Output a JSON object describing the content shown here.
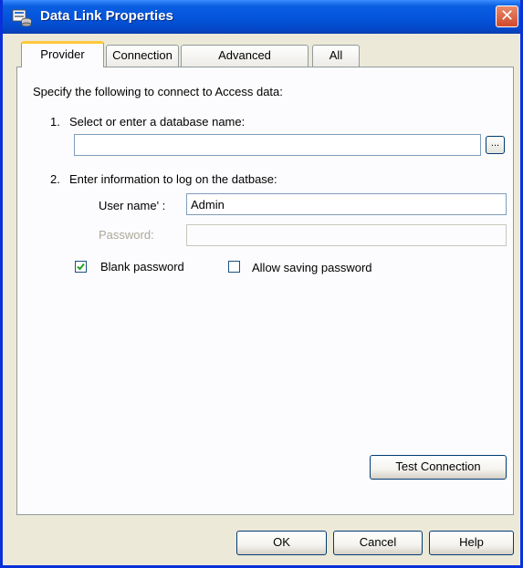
{
  "window": {
    "title": "Data Link Properties",
    "close_symbol": "✕"
  },
  "tabs": [
    {
      "label": "Provider",
      "active": true
    },
    {
      "label": "Connection",
      "active": false
    },
    {
      "label": "Advanced",
      "active": false
    },
    {
      "label": "All",
      "active": false
    }
  ],
  "panel": {
    "intro": "Specify the following to connect to Access data:",
    "step1": {
      "number": "1.",
      "label": "Select or enter a database name:",
      "value": "",
      "browse_label": "..."
    },
    "step2": {
      "number": "2.",
      "label": "Enter information to log on the datbase:"
    },
    "username": {
      "label": "User name' :",
      "value": "Admin"
    },
    "password": {
      "label": "Password:",
      "value": "",
      "enabled": false
    },
    "blank_password": {
      "label": "Blank password",
      "checked": true
    },
    "allow_saving": {
      "label": "Allow saving password",
      "checked": false
    },
    "test_connection_label": "Test Connection"
  },
  "footer": {
    "ok_label": "OK",
    "cancel_label": "Cancel",
    "help_label": "Help"
  },
  "colors": {
    "titlebar": "#0555dd",
    "tab_highlight": "#ffc83c",
    "check": "#21a121"
  }
}
